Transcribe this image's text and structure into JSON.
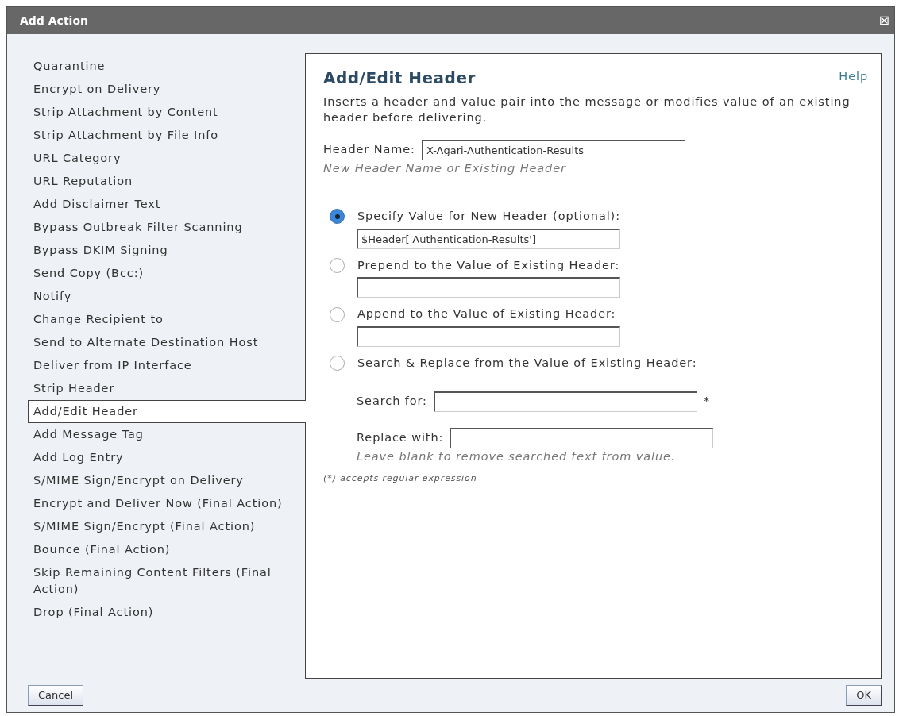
{
  "window": {
    "title": "Add Action",
    "close": "⊠"
  },
  "actions": [
    {
      "label": "Quarantine",
      "selected": false
    },
    {
      "label": "Encrypt on Delivery",
      "selected": false
    },
    {
      "label": "Strip Attachment by Content",
      "selected": false
    },
    {
      "label": "Strip Attachment by File Info",
      "selected": false
    },
    {
      "label": "URL Category",
      "selected": false
    },
    {
      "label": "URL Reputation",
      "selected": false
    },
    {
      "label": "Add Disclaimer Text",
      "selected": false
    },
    {
      "label": "Bypass Outbreak Filter Scanning",
      "selected": false
    },
    {
      "label": "Bypass DKIM Signing",
      "selected": false
    },
    {
      "label": "Send Copy (Bcc:)",
      "selected": false
    },
    {
      "label": "Notify",
      "selected": false
    },
    {
      "label": "Change Recipient to",
      "selected": false
    },
    {
      "label": "Send to Alternate Destination Host",
      "selected": false
    },
    {
      "label": "Deliver from IP Interface",
      "selected": false
    },
    {
      "label": "Strip Header",
      "selected": false
    },
    {
      "label": "Add/Edit Header",
      "selected": true
    },
    {
      "label": "Add Message Tag",
      "selected": false
    },
    {
      "label": "Add Log Entry",
      "selected": false
    },
    {
      "label": "S/MIME Sign/Encrypt on Delivery",
      "selected": false
    },
    {
      "label": "Encrypt and Deliver Now (Final Action)",
      "selected": false
    },
    {
      "label": "S/MIME Sign/Encrypt (Final Action)",
      "selected": false
    },
    {
      "label": "Bounce (Final Action)",
      "selected": false
    },
    {
      "label": "Skip Remaining Content Filters (Final Action)",
      "selected": false
    },
    {
      "label": "Drop (Final Action)",
      "selected": false
    }
  ],
  "panel": {
    "title": "Add/Edit Header",
    "help": "Help",
    "description": "Inserts a header and value pair into the message or modifies value of an existing header before delivering.",
    "header_name": {
      "label": "Header Name:",
      "value": "X-Agari-Authentication-Results",
      "hint": "New Header Name or Existing Header"
    },
    "options": [
      {
        "label": "Specify Value for New Header (optional):",
        "selected": true,
        "kind": "field",
        "value": "$Header['Authentication-Results']"
      },
      {
        "label": "Prepend to the Value of Existing Header:",
        "selected": false,
        "kind": "field"
      },
      {
        "label": "Append to the Value of Existing Header:",
        "selected": false,
        "kind": "field"
      },
      {
        "label": "Search & Replace from the Value of Existing Header:",
        "selected": false,
        "kind": "search"
      }
    ],
    "search_for": {
      "label": "Search for:",
      "marker": "*"
    },
    "replace_with": {
      "label": "Replace with:",
      "hint": "Leave blank to remove searched text from value."
    },
    "footnote": "(*) accepts regular expression"
  },
  "buttons": {
    "cancel": "Cancel",
    "ok": "OK"
  }
}
